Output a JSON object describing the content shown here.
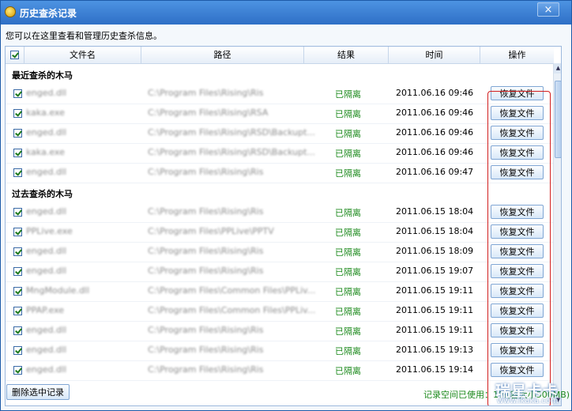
{
  "window": {
    "title": "历史查杀记录",
    "close_label": "×"
  },
  "description": "您可以在这里查看和管理历史查杀信息。",
  "table": {
    "columns": [
      "文件名",
      "路径",
      "结果",
      "时间",
      "操作"
    ]
  },
  "groups": [
    {
      "label": "最近查杀的木马",
      "rows": [
        {
          "file": "enged.dll",
          "path": "C:\\Program Files\\Rising\\Ris",
          "result": "已隔离",
          "time": "2011.06.16 09:46",
          "action": "恢复文件"
        },
        {
          "file": "kaka.exe",
          "path": "C:\\Program Files\\Rising\\RSA",
          "result": "已隔离",
          "time": "2011.06.16 09:46",
          "action": "恢复文件"
        },
        {
          "file": "enged.dll",
          "path": "C:\\Program Files\\Rising\\RSD\\Backupt...",
          "result": "已隔离",
          "time": "2011.06.16 09:46",
          "action": "恢复文件"
        },
        {
          "file": "kaka.exe",
          "path": "C:\\Program Files\\Rising\\RSD\\Backupt...",
          "result": "已隔离",
          "time": "2011.06.16 09:46",
          "action": "恢复文件"
        },
        {
          "file": "enged.dll",
          "path": "C:\\Program Files\\Rising\\Ris",
          "result": "已隔离",
          "time": "2011.06.16 09:47",
          "action": "恢复文件"
        }
      ]
    },
    {
      "label": "过去查杀的木马",
      "rows": [
        {
          "file": "enged.dll",
          "path": "C:\\Program Files\\Rising\\Ris",
          "result": "已隔离",
          "time": "2011.06.15 18:04",
          "action": "恢复文件"
        },
        {
          "file": "PPLive.exe",
          "path": "C:\\Program Files\\PPLive\\PPTV",
          "result": "已隔离",
          "time": "2011.06.15 18:04",
          "action": "恢复文件"
        },
        {
          "file": "enged.dll",
          "path": "C:\\Program Files\\Rising\\Ris",
          "result": "已隔离",
          "time": "2011.06.15 18:09",
          "action": "恢复文件"
        },
        {
          "file": "enged.dll",
          "path": "C:\\Program Files\\Rising\\Ris",
          "result": "已隔离",
          "time": "2011.06.15 19:07",
          "action": "恢复文件"
        },
        {
          "file": "MngModule.dll",
          "path": "C:\\Program Files\\Common Files\\PPLiv...",
          "result": "已隔离",
          "time": "2011.06.15 19:11",
          "action": "恢复文件"
        },
        {
          "file": "PPAP.exe",
          "path": "C:\\Program Files\\Common Files\\PPLiv...",
          "result": "已隔离",
          "time": "2011.06.15 19:11",
          "action": "恢复文件"
        },
        {
          "file": "enged.dll",
          "path": "C:\\Program Files\\Rising\\Ris",
          "result": "已隔离",
          "time": "2011.06.15 19:11",
          "action": "恢复文件"
        },
        {
          "file": "enged.dll",
          "path": "C:\\Program Files\\Rising\\Ris",
          "result": "已隔离",
          "time": "2011.06.15 19:13",
          "action": "恢复文件"
        },
        {
          "file": "enged.dll",
          "path": "C:\\Program Files\\Rising\\Ris",
          "result": "已隔离",
          "time": "2011.06.15 19:14",
          "action": "恢复文件"
        }
      ]
    }
  ],
  "footer": {
    "delete_button": "删除选中记录",
    "status": "记录空间已使用：1%(容大小500MB)"
  },
  "watermark": {
    "line1": "瑞星卡卡",
    "line2": "www.ikaka.com"
  },
  "colors": {
    "titlebar": "#2e6fc6",
    "status_green": "#1d8a1d",
    "highlight_red": "#d21f1f"
  }
}
